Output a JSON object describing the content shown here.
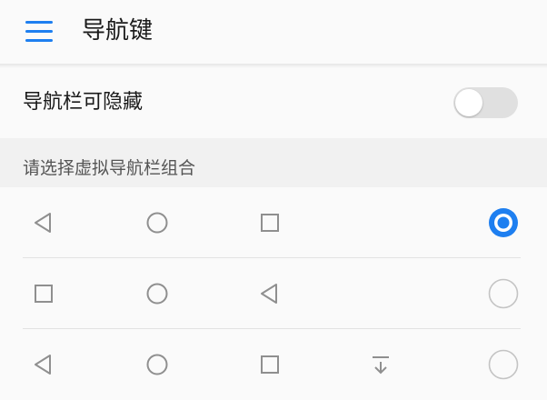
{
  "appbar": {
    "title": "导航键",
    "menu_icon": "hamburger-menu-icon"
  },
  "hide_nav_bar": {
    "label": "导航栏可隐藏",
    "enabled": false
  },
  "combinations": {
    "header": "请选择虚拟导航栏组合",
    "options": [
      {
        "icons": [
          "back",
          "home",
          "recents"
        ],
        "selected": true
      },
      {
        "icons": [
          "recents",
          "home",
          "back"
        ],
        "selected": false
      },
      {
        "icons": [
          "back",
          "home",
          "recents",
          "notification"
        ],
        "selected": false
      }
    ]
  },
  "colors": {
    "accent": "#1e7ff0",
    "icon_gray": "#8f8f8f",
    "radio_off": "#c4c4c4",
    "switch_off": "#e0e0e0"
  }
}
